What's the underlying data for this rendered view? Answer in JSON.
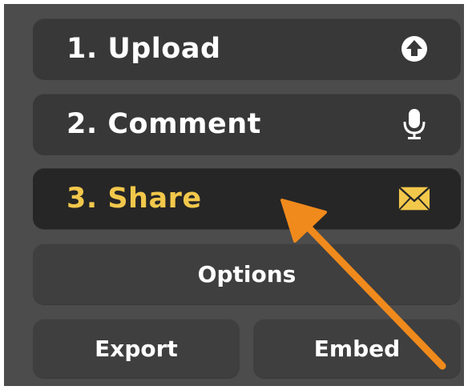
{
  "steps": [
    {
      "label": "1. Upload",
      "icon": "upload-icon",
      "active": false
    },
    {
      "label": "2. Comment",
      "icon": "microphone-icon",
      "active": false
    },
    {
      "label": "3. Share",
      "icon": "envelope-icon",
      "active": true
    }
  ],
  "buttons": {
    "options": "Options",
    "export": "Export",
    "embed": "Embed"
  },
  "colors": {
    "panel": "#4c4c4c",
    "button": "#383838",
    "active_button": "#262626",
    "active_text": "#f2c84b",
    "arrow": "#f08a1c"
  }
}
